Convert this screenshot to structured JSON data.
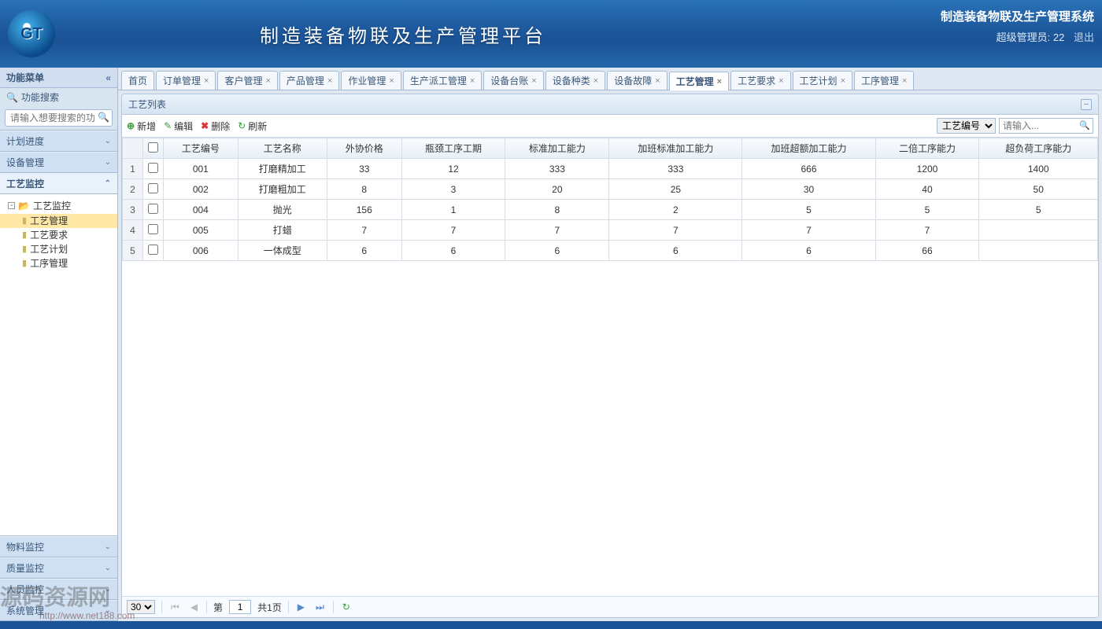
{
  "header": {
    "app_title": "制造装备物联及生产管理平台",
    "system_name": "制造装备物联及生产管理系统",
    "user_label": "超级管理员: 22",
    "logout": "退出"
  },
  "sidebar": {
    "title": "功能菜单",
    "search_label": "功能搜索",
    "search_placeholder": "请输入想要搜索的功能",
    "sections": [
      {
        "label": "计划进度",
        "expanded": false
      },
      {
        "label": "设备管理",
        "expanded": false
      },
      {
        "label": "工艺监控",
        "expanded": true
      }
    ],
    "tree_root": "工艺监控",
    "tree_items": [
      {
        "label": "工艺管理",
        "selected": true
      },
      {
        "label": "工艺要求",
        "selected": false
      },
      {
        "label": "工艺计划",
        "selected": false
      },
      {
        "label": "工序管理",
        "selected": false
      }
    ],
    "bottom_sections": [
      {
        "label": "物料监控"
      },
      {
        "label": "质量监控"
      },
      {
        "label": "人员监控"
      },
      {
        "label": "系统管理"
      }
    ]
  },
  "tabs": [
    {
      "label": "首页",
      "closable": false
    },
    {
      "label": "订单管理",
      "closable": true
    },
    {
      "label": "客户管理",
      "closable": true
    },
    {
      "label": "产品管理",
      "closable": true
    },
    {
      "label": "作业管理",
      "closable": true
    },
    {
      "label": "生产派工管理",
      "closable": true
    },
    {
      "label": "设备台账",
      "closable": true
    },
    {
      "label": "设备种类",
      "closable": true
    },
    {
      "label": "设备故障",
      "closable": true
    },
    {
      "label": "工艺管理",
      "closable": true,
      "active": true
    },
    {
      "label": "工艺要求",
      "closable": true
    },
    {
      "label": "工艺计划",
      "closable": true
    },
    {
      "label": "工序管理",
      "closable": true
    }
  ],
  "panel": {
    "title": "工艺列表",
    "toolbar": {
      "add": "新增",
      "edit": "编辑",
      "delete": "删除",
      "refresh": "刷新",
      "filter_field": "工艺编号",
      "filter_placeholder": "请输入..."
    },
    "columns": [
      "工艺编号",
      "工艺名称",
      "外协价格",
      "瓶颈工序工期",
      "标准加工能力",
      "加班标准加工能力",
      "加班超额加工能力",
      "二倍工序能力",
      "超负荷工序能力"
    ],
    "rows": [
      {
        "n": 1,
        "c": [
          "001",
          "打磨精加工",
          "33",
          "12",
          "333",
          "333",
          "666",
          "1200",
          "1400"
        ]
      },
      {
        "n": 2,
        "c": [
          "002",
          "打磨粗加工",
          "8",
          "3",
          "20",
          "25",
          "30",
          "40",
          "50"
        ]
      },
      {
        "n": 3,
        "c": [
          "004",
          "抛光",
          "156",
          "1",
          "8",
          "2",
          "5",
          "5",
          "5"
        ]
      },
      {
        "n": 4,
        "c": [
          "005",
          "打蜡",
          "7",
          "7",
          "7",
          "7",
          "7",
          "7",
          ""
        ]
      },
      {
        "n": 5,
        "c": [
          "006",
          "一体成型",
          "6",
          "6",
          "6",
          "6",
          "6",
          "66",
          ""
        ]
      }
    ],
    "pager": {
      "page_size": "30",
      "page_label_prefix": "第",
      "page": "1",
      "total_label": "共1页"
    }
  },
  "watermark": {
    "text": "源码资源网",
    "url": "http://www.net188.com"
  }
}
